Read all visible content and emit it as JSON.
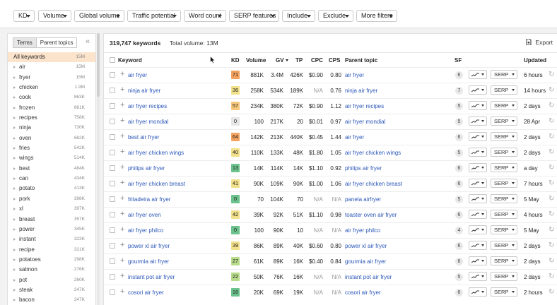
{
  "filters": [
    "KD",
    "Volume",
    "Global volume",
    "Traffic potential",
    "Word count",
    "SERP features",
    "Include",
    "Exclude",
    "More filters"
  ],
  "sidebar": {
    "tabs": [
      "Terms",
      "Parent topics"
    ],
    "active_tab": "Terms",
    "items": [
      {
        "label": "All keywords",
        "count": "15M",
        "active": true
      },
      {
        "label": "air",
        "count": "15M"
      },
      {
        "label": "fryer",
        "count": "15M"
      },
      {
        "label": "chicken",
        "count": "1.9M"
      },
      {
        "label": "cook",
        "count": "863K"
      },
      {
        "label": "frozen",
        "count": "861K"
      },
      {
        "label": "recipes",
        "count": "758K"
      },
      {
        "label": "ninja",
        "count": "730K"
      },
      {
        "label": "oven",
        "count": "662K"
      },
      {
        "label": "fries",
        "count": "542K"
      },
      {
        "label": "wings",
        "count": "514K"
      },
      {
        "label": "best",
        "count": "484K"
      },
      {
        "label": "can",
        "count": "434K"
      },
      {
        "label": "potato",
        "count": "413K"
      },
      {
        "label": "pork",
        "count": "398K"
      },
      {
        "label": "xl",
        "count": "397K"
      },
      {
        "label": "breast",
        "count": "357K"
      },
      {
        "label": "power",
        "count": "345K"
      },
      {
        "label": "instant",
        "count": "323K"
      },
      {
        "label": "recipe",
        "count": "321K"
      },
      {
        "label": "potatoes",
        "count": "298K"
      },
      {
        "label": "salmon",
        "count": "276K"
      },
      {
        "label": "pot",
        "count": "260K"
      },
      {
        "label": "steak",
        "count": "247K"
      },
      {
        "label": "bacon",
        "count": "247K"
      }
    ]
  },
  "summary": {
    "keywords": "319,747 keywords",
    "total_volume": "Total volume: 13M"
  },
  "export_label": "Export",
  "columns": {
    "keyword": "Keyword",
    "kd": "KD",
    "volume": "Volume",
    "gv": "GV",
    "tp": "TP",
    "cpc": "CPC",
    "cps": "CPS",
    "parent_topic": "Parent topic",
    "sf": "SF",
    "updated": "Updated"
  },
  "serp_label": "SERP",
  "kd_colors": {
    "orange": "#f5a25e",
    "light_orange": "#f8c77a",
    "yellow": "#f2e08a",
    "light_green": "#b9dc8b",
    "green": "#6cc28c",
    "grey": "#e6e6e6"
  },
  "rows": [
    {
      "keyword": "air fryer",
      "kd": "71",
      "kd_color": "#f5a25e",
      "volume": "881K",
      "gv": "3.4M",
      "tp": "426K",
      "cpc": "$0.90",
      "cps": "0.80",
      "parent_topic": "air fryer",
      "sf": "6",
      "updated": "6 hours"
    },
    {
      "keyword": "ninja air fryer",
      "kd": "36",
      "kd_color": "#f2e08a",
      "volume": "258K",
      "gv": "534K",
      "tp": "189K",
      "cpc": "N/A",
      "cps": "0.76",
      "parent_topic": "ninja air fryer",
      "sf": "7",
      "updated": "14 hours"
    },
    {
      "keyword": "air fryer recipes",
      "kd": "57",
      "kd_color": "#f8c77a",
      "volume": "234K",
      "gv": "380K",
      "tp": "72K",
      "cpc": "$0.90",
      "cps": "1.12",
      "parent_topic": "air fryer recipes",
      "sf": "5",
      "updated": "2 days"
    },
    {
      "keyword": "air fryer mondial",
      "kd": "0",
      "kd_color": "#e6e6e6",
      "volume": "100",
      "gv": "217K",
      "tp": "20",
      "cpc": "$0.01",
      "cps": "0.97",
      "parent_topic": "air fryer mondial",
      "sf": "5",
      "updated": "28 Apr"
    },
    {
      "keyword": "best air fryer",
      "kd": "64",
      "kd_color": "#f5a25e",
      "volume": "142K",
      "gv": "213K",
      "tp": "440K",
      "cpc": "$0.45",
      "cps": "1.44",
      "parent_topic": "air fryer",
      "sf": "6",
      "updated": "2 days"
    },
    {
      "keyword": "air fryer chicken wings",
      "kd": "40",
      "kd_color": "#f2e08a",
      "volume": "110K",
      "gv": "133K",
      "tp": "48K",
      "cpc": "$1.80",
      "cps": "1.05",
      "parent_topic": "air fryer chicken wings",
      "sf": "5",
      "updated": "2 days"
    },
    {
      "keyword": "philips air fryer",
      "kd": "13",
      "kd_color": "#6cc28c",
      "volume": "14K",
      "gv": "114K",
      "tp": "14K",
      "cpc": "$1.10",
      "cps": "0.92",
      "parent_topic": "philips air fryer",
      "sf": "6",
      "updated": "a day"
    },
    {
      "keyword": "air fryer chicken breast",
      "kd": "41",
      "kd_color": "#f2e08a",
      "volume": "90K",
      "gv": "109K",
      "tp": "90K",
      "cpc": "$1.00",
      "cps": "1.06",
      "parent_topic": "air fryer chicken breast",
      "sf": "6",
      "updated": "7 hours"
    },
    {
      "keyword": "fritadeira air fryer",
      "kd": "0",
      "kd_color": "#6cc28c",
      "volume": "70",
      "gv": "104K",
      "tp": "70",
      "cpc": "N/A",
      "cps": "N/A",
      "parent_topic": "panela airfryer",
      "sf": "5",
      "updated": "5 May"
    },
    {
      "keyword": "air fryer oven",
      "kd": "42",
      "kd_color": "#f2e08a",
      "volume": "39K",
      "gv": "92K",
      "tp": "51K",
      "cpc": "$1.10",
      "cps": "0.98",
      "parent_topic": "toaster oven air fryer",
      "sf": "6",
      "updated": "4 hours"
    },
    {
      "keyword": "air fryer philco",
      "kd": "0",
      "kd_color": "#6cc28c",
      "volume": "100",
      "gv": "90K",
      "tp": "10",
      "cpc": "N/A",
      "cps": "N/A",
      "parent_topic": "air fryer philco",
      "sf": "4",
      "updated": "5 May"
    },
    {
      "keyword": "power xl air fryer",
      "kd": "39",
      "kd_color": "#f2e08a",
      "volume": "86K",
      "gv": "89K",
      "tp": "40K",
      "cpc": "$0.60",
      "cps": "0.80",
      "parent_topic": "power xl air fryer",
      "sf": "6",
      "updated": "2 days"
    },
    {
      "keyword": "gourmia air fryer",
      "kd": "27",
      "kd_color": "#b9dc8b",
      "volume": "61K",
      "gv": "89K",
      "tp": "16K",
      "cpc": "$0.40",
      "cps": "0.84",
      "parent_topic": "gourmia air fryer",
      "sf": "6",
      "updated": "2 days"
    },
    {
      "keyword": "instant pot air fryer",
      "kd": "22",
      "kd_color": "#b9dc8b",
      "volume": "50K",
      "gv": "76K",
      "tp": "16K",
      "cpc": "N/A",
      "cps": "N/A",
      "parent_topic": "instant pot air fryer",
      "sf": "5",
      "updated": "2 days"
    },
    {
      "keyword": "cosori air fryer",
      "kd": "16",
      "kd_color": "#6cc28c",
      "volume": "20K",
      "gv": "69K",
      "tp": "19K",
      "cpc": "N/A",
      "cps": "N/A",
      "parent_topic": "cosori air fryer",
      "sf": "6",
      "updated": "2 hours"
    }
  ]
}
